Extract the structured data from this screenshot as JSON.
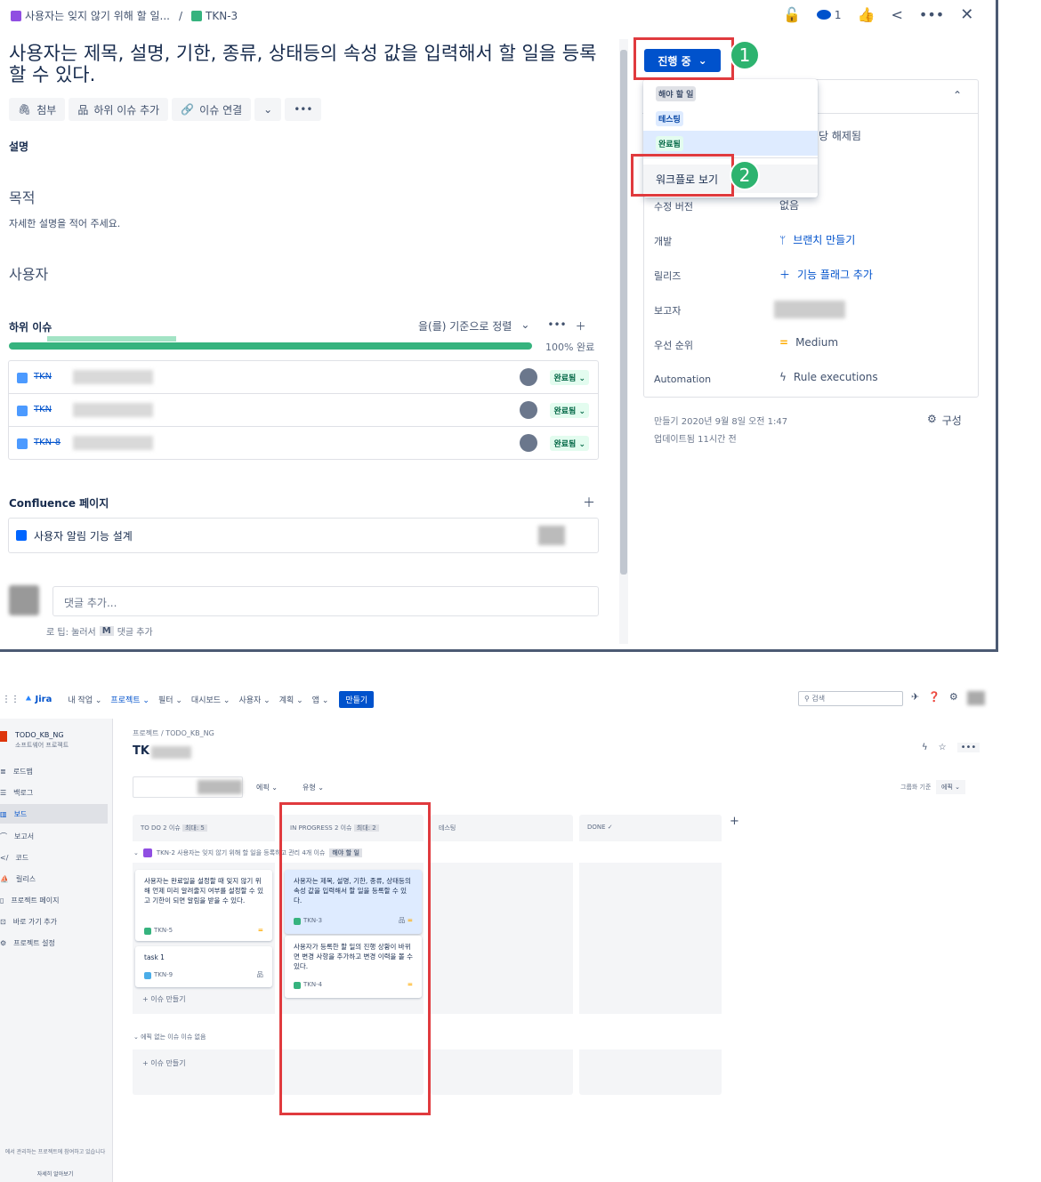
{
  "breadcrumb": {
    "parent": "사용자는 잊지 않기 위해 할 일...",
    "sep": "/",
    "key": "TKN-3"
  },
  "header": {
    "watch_count": "1"
  },
  "issue": {
    "title": "사용자는 제목, 설명, 기한, 종류, 상태등의 속성 값을 입력해서 할 일을 등록할 수 있다.",
    "attach": "첨부",
    "add_child": "하위 이슈 추가",
    "link": "이슈 연결",
    "desc_label": "설명",
    "purpose": "목적",
    "purpose_text": "자세한 설명을 적어 주세요.",
    "user": "사용자",
    "children_label": "하위 이슈",
    "sort": "을(를) 기준으로 정렬",
    "percent": "100% 완료",
    "child_rows": [
      {
        "key": "TKN",
        "status": "완료됨"
      },
      {
        "key": "TKN",
        "status": "완료됨"
      },
      {
        "key": "TKN-8",
        "status": "완료됨"
      }
    ],
    "confluence": "Confluence 페이지",
    "conf_page": "사용자 알림 기능 설계",
    "comment_ph": "댓글 추가...",
    "tip_pre": "로 팁: 눌러서",
    "tip_key": "M",
    "tip_post": "댓글 추가"
  },
  "status": {
    "current": "진행 중",
    "options": [
      "해야 할 일",
      "테스팅",
      "완료됨"
    ],
    "workflow": "워크플로 보기",
    "badge1": "1",
    "badge2": "2"
  },
  "details": {
    "assignee_tail": "당 해제됨",
    "fields": [
      {
        "label": "수정 버전",
        "value": "없음"
      },
      {
        "label": "개발",
        "value": "브랜치 만들기"
      },
      {
        "label": "릴리즈",
        "value": "기능 플래그 추가"
      },
      {
        "label": "보고자",
        "value": ""
      },
      {
        "label": "우선 순위",
        "value": "Medium"
      },
      {
        "label": "Automation",
        "value": "Rule executions"
      }
    ],
    "created": "만들기 2020년 9월 8일 오전 1:47",
    "updated": "업데이트됨 11시간 전",
    "config": "구성"
  },
  "board": {
    "logo": "Jira",
    "nav": [
      "내 작업 ⌄",
      "프로젝트 ⌄",
      "필터 ⌄",
      "대시보드 ⌄",
      "사용자 ⌄",
      "계획 ⌄",
      "앱 ⌄"
    ],
    "create": "만들기",
    "search": "검색",
    "project": "TODO_KB_NG",
    "project_type": "소프트웨어 프로젝트",
    "sidebar": [
      "로드맵",
      "백로그",
      "보드",
      "보고서",
      "코드",
      "릴리스",
      "프로젝트 페이지",
      "바로 가기 추가",
      "프로젝트 설정"
    ],
    "sidebar_foot": "에서 관리하는 프로젝트에 참여하고 있습니다",
    "sidebar_more": "자세히 알아보기",
    "crumb": "프로젝트 / TODO_KB_NG",
    "board_title": "TK",
    "filter_epic": "에픽 ⌄",
    "filter_type": "유형 ⌄",
    "group_label": "그룹화 기준",
    "group_val": "에픽 ⌄",
    "cols": [
      {
        "name": "TO DO 2 이슈",
        "badge": "최대: 5"
      },
      {
        "name": "IN PROGRESS 2 이슈",
        "badge": "최대: 2"
      },
      {
        "name": "테스팅",
        "badge": ""
      },
      {
        "name": "DONE ✓",
        "badge": ""
      }
    ],
    "epic": "TKN-2 사용자는 잊지 않기 위해 할 일을 등록하고 관리 4개 이슈",
    "epic_badge": "해야 할 일",
    "cards": [
      {
        "text": "사용자는 완료일을 설정할 때 잊지 않기 위해 언제 미리 알려줄지 여부를 설정할 수 있고 기한이 되면 알림을 받을 수 있다.",
        "key": "TKN-5"
      },
      {
        "text": "task 1",
        "key": "TKN-9"
      },
      {
        "text": "사용자는 제목, 설명, 기한, 종류, 상태등의 속성 값을 입력해서 할 일을 등록할 수 있다.",
        "key": "TKN-3"
      },
      {
        "text": "사용자가 등록한 할 일의 진행 상황이 바뀌면 변경 사항을 추가하고 변경 이력을 볼 수 있다.",
        "key": "TKN-4"
      }
    ],
    "create_issue": "+ 이슈 만들기",
    "no_epic": "⌄ 에픽 없는 이슈",
    "no_epic_tail": "이슈 없음",
    "add_col": "+"
  }
}
